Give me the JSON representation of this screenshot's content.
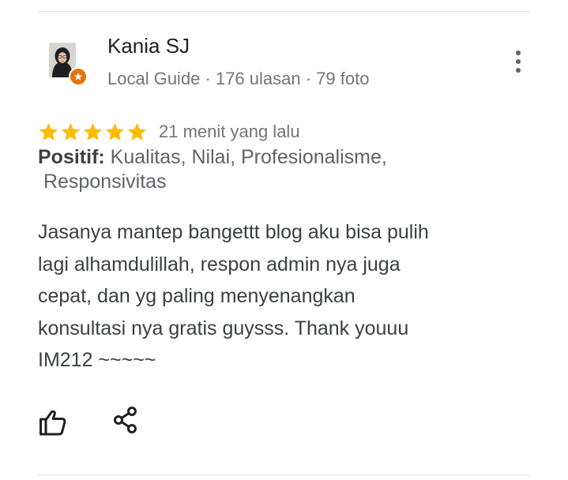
{
  "review": {
    "reviewer": {
      "name": "Kania SJ",
      "meta": "Local Guide · 176 ulasan · 79 foto",
      "avatar_icon": "person-hijab-avatar",
      "badge_icon": "local-guide-star-badge",
      "badge_color": "#e8710a"
    },
    "rating": {
      "stars": 5,
      "max_stars": 5,
      "star_color": "#fbbc04",
      "time": "21 menit yang lalu"
    },
    "positives": {
      "label": "Positif:",
      "text": " Kualitas, Nilai, Profesionalisme,",
      "text2": "Responsivitas"
    },
    "body": [
      "Jasanya mantep bangettt blog aku bisa pulih",
      "lagi alhamdulillah, respon admin nya juga",
      "cepat, dan yg paling menyenangkan",
      "konsultasi nya gratis guysss. Thank youuu",
      "IM212 ~~~~~"
    ],
    "actions": {
      "like_icon": "thumbs-up-icon",
      "share_icon": "share-icon",
      "more_icon": "more-vert-icon"
    }
  }
}
